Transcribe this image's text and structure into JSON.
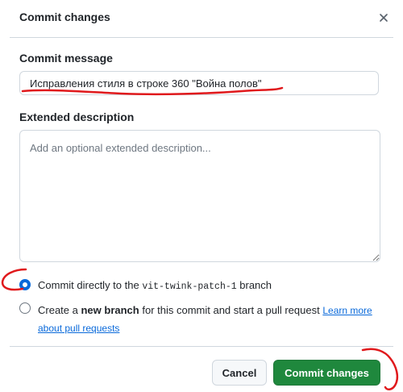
{
  "dialog": {
    "title": "Commit changes",
    "close_icon": "close-icon"
  },
  "commit_message": {
    "label": "Commit message",
    "value": "Исправления стиля в строке 360 \"Война полов\""
  },
  "extended_description": {
    "label": "Extended description",
    "placeholder": "Add an optional extended description..."
  },
  "options": {
    "direct": {
      "prefix": "Commit directly to the ",
      "branch": "vit-twink-patch-1",
      "suffix": " branch",
      "selected": true
    },
    "new_branch": {
      "prefix": "Create a ",
      "bold": "new branch",
      "suffix": " for this commit and start a pull request ",
      "link": "Learn more about pull requests",
      "selected": false
    }
  },
  "buttons": {
    "cancel": "Cancel",
    "commit": "Commit changes"
  },
  "colors": {
    "accent": "#0969da",
    "primary_button": "#1f883d",
    "annotation": "#e0191c"
  }
}
